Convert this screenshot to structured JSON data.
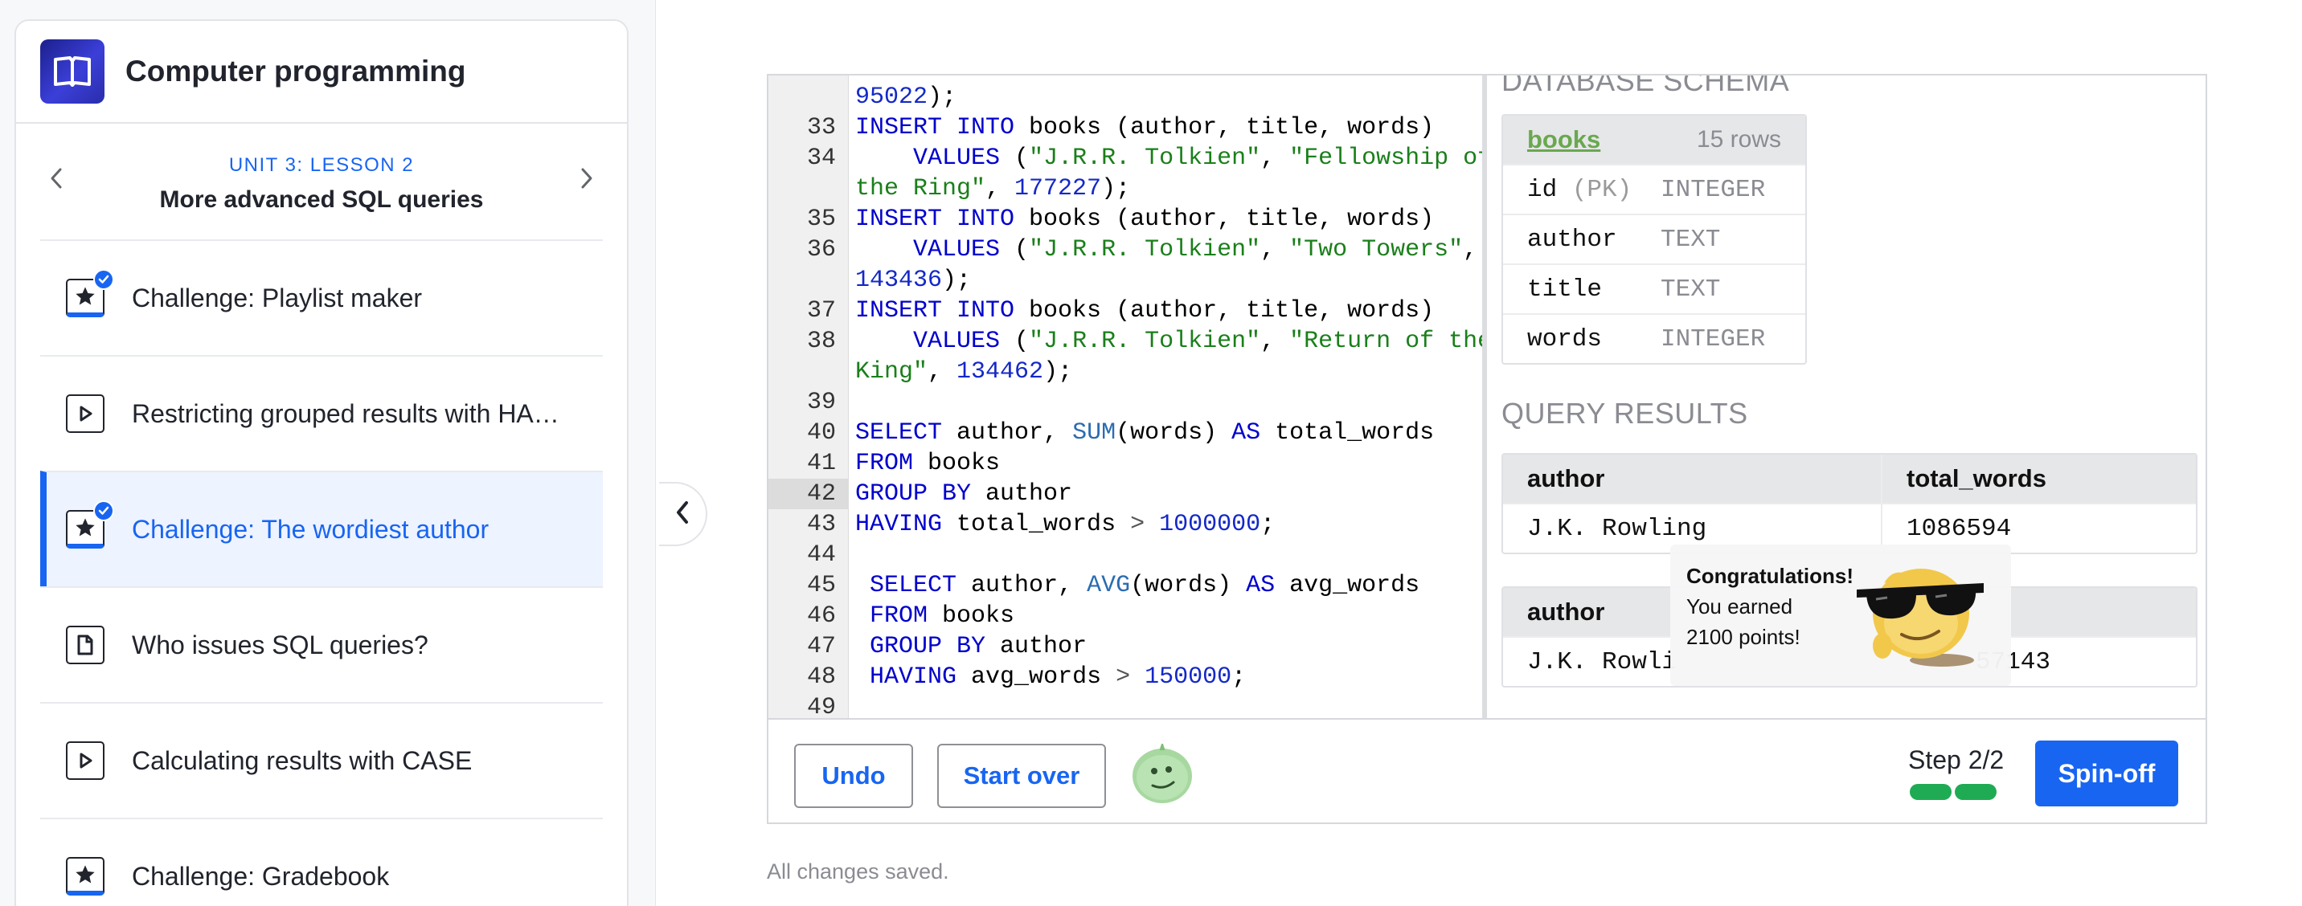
{
  "sidebar": {
    "course_title": "Computer programming",
    "unit_label": "UNIT 3: LESSON 2",
    "lesson_title": "More advanced SQL queries",
    "items": [
      {
        "label": "Challenge: Playlist maker",
        "type": "challenge",
        "completed": true,
        "active": false
      },
      {
        "label": "Restricting grouped results with HA…",
        "type": "video",
        "completed": false,
        "active": false
      },
      {
        "label": "Challenge: The wordiest author",
        "type": "challenge",
        "completed": true,
        "active": true
      },
      {
        "label": "Who issues SQL queries?",
        "type": "article",
        "completed": false,
        "active": false
      },
      {
        "label": "Calculating results with CASE",
        "type": "video",
        "completed": false,
        "active": false
      },
      {
        "label": "Challenge: Gradebook",
        "type": "challenge",
        "completed": false,
        "active": false
      }
    ]
  },
  "code": {
    "highlighted_line": "42",
    "lines": [
      {
        "n": "",
        "t": [
          [
            "num",
            "95022"
          ],
          [
            "",
            ");"
          ]
        ]
      },
      {
        "n": "33",
        "t": [
          [
            "kw",
            "INSERT INTO"
          ],
          [
            "",
            " books (author, title, words)"
          ]
        ]
      },
      {
        "n": "34",
        "t": [
          [
            "",
            "    "
          ],
          [
            "kw",
            "VALUES"
          ],
          [
            "",
            " ("
          ],
          [
            "str",
            "\"J.R.R. Tolkien\""
          ],
          [
            "",
            ", "
          ],
          [
            "str",
            "\"Fellowship of"
          ]
        ]
      },
      {
        "n": "",
        "t": [
          [
            "str",
            "the Ring\""
          ],
          [
            "",
            ", "
          ],
          [
            "num",
            "177227"
          ],
          [
            "",
            ");"
          ]
        ]
      },
      {
        "n": "35",
        "t": [
          [
            "kw",
            "INSERT INTO"
          ],
          [
            "",
            " books (author, title, words)"
          ]
        ]
      },
      {
        "n": "36",
        "t": [
          [
            "",
            "    "
          ],
          [
            "kw",
            "VALUES"
          ],
          [
            "",
            " ("
          ],
          [
            "str",
            "\"J.R.R. Tolkien\""
          ],
          [
            "",
            ", "
          ],
          [
            "str",
            "\"Two Towers\""
          ],
          [
            "",
            ","
          ]
        ]
      },
      {
        "n": "",
        "t": [
          [
            "num",
            "143436"
          ],
          [
            "",
            ");"
          ]
        ]
      },
      {
        "n": "37",
        "t": [
          [
            "kw",
            "INSERT INTO"
          ],
          [
            "",
            " books (author, title, words)"
          ]
        ]
      },
      {
        "n": "38",
        "t": [
          [
            "",
            "    "
          ],
          [
            "kw",
            "VALUES"
          ],
          [
            "",
            " ("
          ],
          [
            "str",
            "\"J.R.R. Tolkien\""
          ],
          [
            "",
            ", "
          ],
          [
            "str",
            "\"Return of the"
          ]
        ]
      },
      {
        "n": "",
        "t": [
          [
            "str",
            "King\""
          ],
          [
            "",
            ", "
          ],
          [
            "num",
            "134462"
          ],
          [
            "",
            ");"
          ]
        ]
      },
      {
        "n": "39",
        "t": []
      },
      {
        "n": "40",
        "t": [
          [
            "kw",
            "SELECT"
          ],
          [
            "",
            " author, "
          ],
          [
            "fn",
            "SUM"
          ],
          [
            "",
            "(words) "
          ],
          [
            "kw",
            "AS"
          ],
          [
            "",
            " total_words"
          ]
        ]
      },
      {
        "n": "41",
        "t": [
          [
            "kw",
            "FROM"
          ],
          [
            "",
            " books"
          ]
        ]
      },
      {
        "n": "42",
        "t": [
          [
            "kw",
            "GROUP BY"
          ],
          [
            "",
            " author"
          ]
        ]
      },
      {
        "n": "43",
        "t": [
          [
            "kw",
            "HAVING"
          ],
          [
            "",
            " total_words "
          ],
          [
            "op",
            ">"
          ],
          [
            "",
            " "
          ],
          [
            "num",
            "1000000"
          ],
          [
            "",
            ";"
          ]
        ]
      },
      {
        "n": "44",
        "t": []
      },
      {
        "n": "45",
        "t": [
          [
            "",
            " "
          ],
          [
            "kw",
            "SELECT"
          ],
          [
            "",
            " author, "
          ],
          [
            "fn",
            "AVG"
          ],
          [
            "",
            "(words) "
          ],
          [
            "kw",
            "AS"
          ],
          [
            "",
            " avg_words"
          ]
        ]
      },
      {
        "n": "46",
        "t": [
          [
            "",
            " "
          ],
          [
            "kw",
            "FROM"
          ],
          [
            "",
            " books"
          ]
        ]
      },
      {
        "n": "47",
        "t": [
          [
            "",
            " "
          ],
          [
            "kw",
            "GROUP BY"
          ],
          [
            "",
            " author"
          ]
        ]
      },
      {
        "n": "48",
        "t": [
          [
            "",
            " "
          ],
          [
            "kw",
            "HAVING"
          ],
          [
            "",
            " avg_words "
          ],
          [
            "op",
            ">"
          ],
          [
            "",
            " "
          ],
          [
            "num",
            "150000"
          ],
          [
            "",
            ";"
          ]
        ]
      },
      {
        "n": "49",
        "t": []
      }
    ]
  },
  "schema": {
    "heading": "DATABASE SCHEMA",
    "table_name": "books",
    "row_count": "15 rows",
    "pk_note": "(PK)",
    "columns": [
      {
        "name": "id",
        "type": "INTEGER"
      },
      {
        "name": "author",
        "type": "TEXT"
      },
      {
        "name": "title",
        "type": "TEXT"
      },
      {
        "name": "words",
        "type": "INTEGER"
      }
    ]
  },
  "results": {
    "heading": "QUERY RESULTS",
    "table1": {
      "col1": "author",
      "col2": "total_words",
      "row_author": "J.K. Rowling",
      "row_value": "1086594"
    },
    "table2": {
      "col1": "author",
      "col2": "",
      "row_author": "J.K. Rowli",
      "row_value": "57143"
    }
  },
  "congrats": {
    "title": "Congratulations!",
    "line1": "You earned",
    "line2": "2100 points!"
  },
  "toolbar": {
    "undo_label": "Undo",
    "start_over_label": "Start over",
    "step_label": "Step 2/2",
    "spinoff_label": "Spin-off"
  },
  "status": {
    "saved_text": "All changes saved."
  },
  "colors": {
    "accent": "#1865f2",
    "progress": "#1fab54",
    "schema_link": "#6aa84f"
  },
  "icons": {
    "course": "book-icon",
    "prev": "chevron-left-icon",
    "next": "chevron-right-icon",
    "collapse": "chevron-left-icon",
    "challenge": "star-icon",
    "video": "play-icon",
    "article": "document-icon",
    "completed": "check-icon"
  }
}
